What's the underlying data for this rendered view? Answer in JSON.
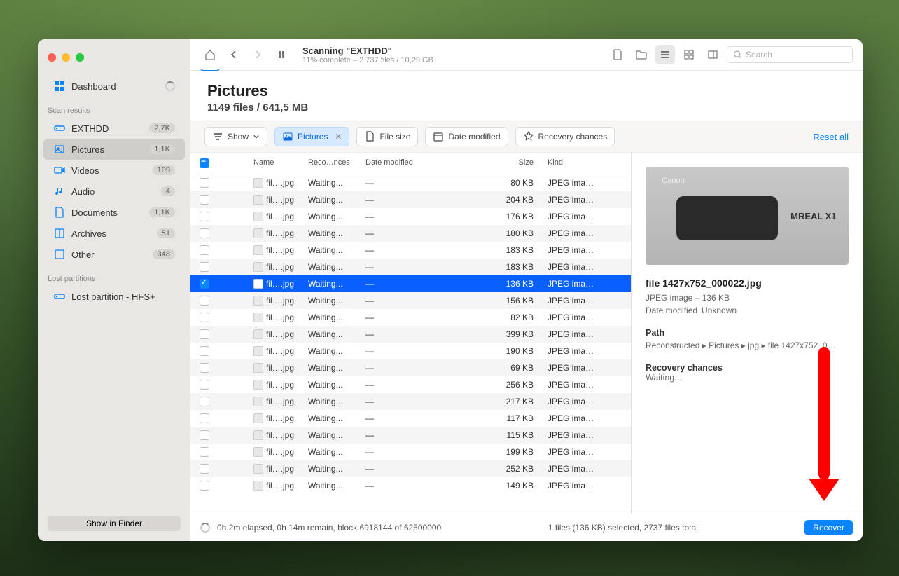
{
  "sidebar": {
    "dashboard": "Dashboard",
    "scan_results_header": "Scan results",
    "lost_partitions_header": "Lost partitions",
    "show_in_finder": "Show in Finder",
    "items": [
      {
        "label": "EXTHDD",
        "badge": "2,7K"
      },
      {
        "label": "Pictures",
        "badge": "1,1K"
      },
      {
        "label": "Videos",
        "badge": "109"
      },
      {
        "label": "Audio",
        "badge": "4"
      },
      {
        "label": "Documents",
        "badge": "1,1K"
      },
      {
        "label": "Archives",
        "badge": "51"
      },
      {
        "label": "Other",
        "badge": "348"
      }
    ],
    "lost_partition": "Lost partition - HFS+"
  },
  "toolbar": {
    "title": "Scanning \"EXTHDD\"",
    "subtitle": "11% complete – 2 737 files / 10,29 GB",
    "search_placeholder": "Search"
  },
  "heading": {
    "title": "Pictures",
    "subtitle": "1149 files / 641,5 MB"
  },
  "filters": {
    "show": "Show",
    "pictures": "Pictures",
    "file_size": "File size",
    "date_modified": "Date modified",
    "recovery": "Recovery chances",
    "reset": "Reset all"
  },
  "columns": {
    "name": "Name",
    "recovery": "Reco…nces",
    "date": "Date modified",
    "size": "Size",
    "kind": "Kind"
  },
  "rows": [
    {
      "name": "fil….jpg",
      "rec": "Waiting...",
      "dm": "—",
      "size": "80 KB",
      "kind": "JPEG ima…"
    },
    {
      "name": "fil….jpg",
      "rec": "Waiting...",
      "dm": "—",
      "size": "204 KB",
      "kind": "JPEG ima…"
    },
    {
      "name": "fil….jpg",
      "rec": "Waiting...",
      "dm": "—",
      "size": "176 KB",
      "kind": "JPEG ima…"
    },
    {
      "name": "fil….jpg",
      "rec": "Waiting...",
      "dm": "—",
      "size": "180 KB",
      "kind": "JPEG ima…"
    },
    {
      "name": "fil….jpg",
      "rec": "Waiting...",
      "dm": "—",
      "size": "183 KB",
      "kind": "JPEG ima…"
    },
    {
      "name": "fil….jpg",
      "rec": "Waiting...",
      "dm": "—",
      "size": "183 KB",
      "kind": "JPEG ima…"
    },
    {
      "name": "fil….jpg",
      "rec": "Waiting...",
      "dm": "—",
      "size": "136 KB",
      "kind": "JPEG ima…",
      "selected": true
    },
    {
      "name": "fil….jpg",
      "rec": "Waiting...",
      "dm": "—",
      "size": "156 KB",
      "kind": "JPEG ima…"
    },
    {
      "name": "fil….jpg",
      "rec": "Waiting...",
      "dm": "—",
      "size": "82 KB",
      "kind": "JPEG ima…"
    },
    {
      "name": "fil….jpg",
      "rec": "Waiting...",
      "dm": "—",
      "size": "399 KB",
      "kind": "JPEG ima…"
    },
    {
      "name": "fil….jpg",
      "rec": "Waiting...",
      "dm": "—",
      "size": "190 KB",
      "kind": "JPEG ima…"
    },
    {
      "name": "fil….jpg",
      "rec": "Waiting...",
      "dm": "—",
      "size": "69 KB",
      "kind": "JPEG ima…"
    },
    {
      "name": "fil….jpg",
      "rec": "Waiting...",
      "dm": "—",
      "size": "256 KB",
      "kind": "JPEG ima…"
    },
    {
      "name": "fil….jpg",
      "rec": "Waiting...",
      "dm": "—",
      "size": "217 KB",
      "kind": "JPEG ima…"
    },
    {
      "name": "fil….jpg",
      "rec": "Waiting...",
      "dm": "—",
      "size": "117 KB",
      "kind": "JPEG ima…"
    },
    {
      "name": "fil….jpg",
      "rec": "Waiting...",
      "dm": "—",
      "size": "115 KB",
      "kind": "JPEG ima…"
    },
    {
      "name": "fil….jpg",
      "rec": "Waiting...",
      "dm": "—",
      "size": "199 KB",
      "kind": "JPEG ima…"
    },
    {
      "name": "fil….jpg",
      "rec": "Waiting...",
      "dm": "—",
      "size": "252 KB",
      "kind": "JPEG ima…"
    },
    {
      "name": "fil….jpg",
      "rec": "Waiting...",
      "dm": "—",
      "size": "149 KB",
      "kind": "JPEG ima…"
    }
  ],
  "preview": {
    "filename": "file 1427x752_000022.jpg",
    "meta": "JPEG image – 136 KB",
    "date_label": "Date modified",
    "date_value": "Unknown",
    "path_label": "Path",
    "path_value": "Reconstructed ▸ Pictures ▸ jpg ▸ file 1427x752_0…",
    "recovery_label": "Recovery chances",
    "recovery_value": "Waiting...",
    "canon": "Canon"
  },
  "status": {
    "progress": "0h 2m elapsed, 0h 14m remain, block 6918144 of 62500000",
    "selection": "1 files (136 KB) selected, 2737 files total",
    "recover": "Recover"
  }
}
